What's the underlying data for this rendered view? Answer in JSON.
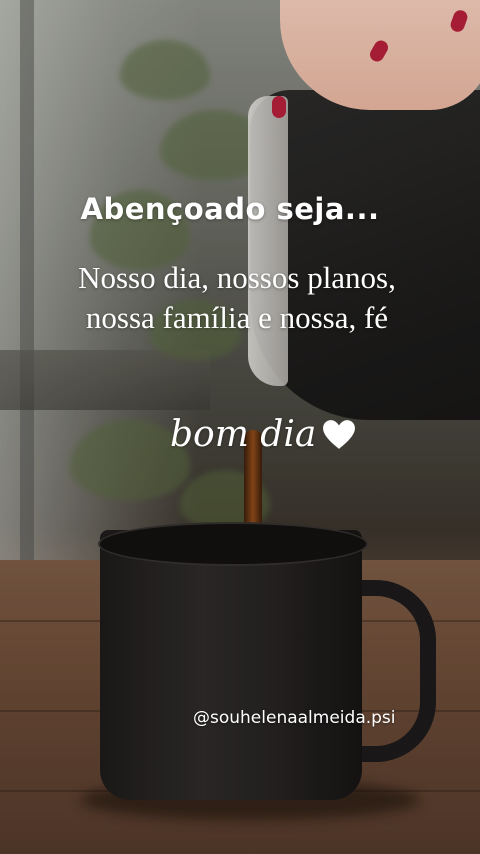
{
  "overlay_text": {
    "headline": "Abençoado seja...",
    "verse_lines": [
      "Nosso dia, nossos planos,",
      "nossa família e nossa, fé"
    ],
    "greeting": "bom dia",
    "greeting_icon": "heart-icon",
    "username": "@souhelenaalmeida.psi"
  },
  "colors": {
    "text": "#ffffff",
    "heart": "#ffffff",
    "nail_polish": "#b3203a"
  }
}
